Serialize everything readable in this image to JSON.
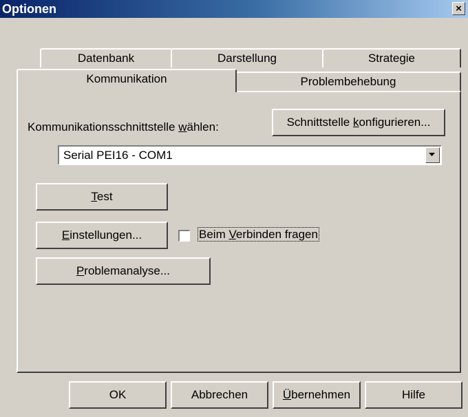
{
  "window": {
    "title": "Optionen",
    "close_glyph": "×"
  },
  "tabs": {
    "row_back": [
      "Datenbank",
      "Darstellung",
      "Strategie"
    ],
    "row_front": [
      "Kommunikation",
      "Problembehebung"
    ],
    "active": "Kommunikation"
  },
  "communication": {
    "interface_label_pre": "Kommunikationsschnittstelle ",
    "interface_label_u": "w",
    "interface_label_post": "ählen:",
    "configure_pre": "Schnittstelle ",
    "configure_u": "k",
    "configure_post": "onfigurieren...",
    "interface_value": "Serial PEI16 - COM1",
    "test_u": "T",
    "test_post": "est",
    "settings_u": "E",
    "settings_post": "instellungen...",
    "ask_pre": "Beim ",
    "ask_u": "V",
    "ask_post": "erbinden fragen",
    "ask_checked": false,
    "analysis_u": "P",
    "analysis_post": "roblemanalyse..."
  },
  "footer": {
    "ok": "OK",
    "cancel": "Abbrechen",
    "apply_u": "Ü",
    "apply_post": "bernehmen",
    "help": "Hilfe"
  },
  "icons": {
    "close": "close-icon",
    "dropdown": "chevron-down-icon"
  },
  "colors": {
    "titlebar_start": "#0a246a",
    "titlebar_end": "#a6caf0",
    "face": "#d4d0c8"
  }
}
